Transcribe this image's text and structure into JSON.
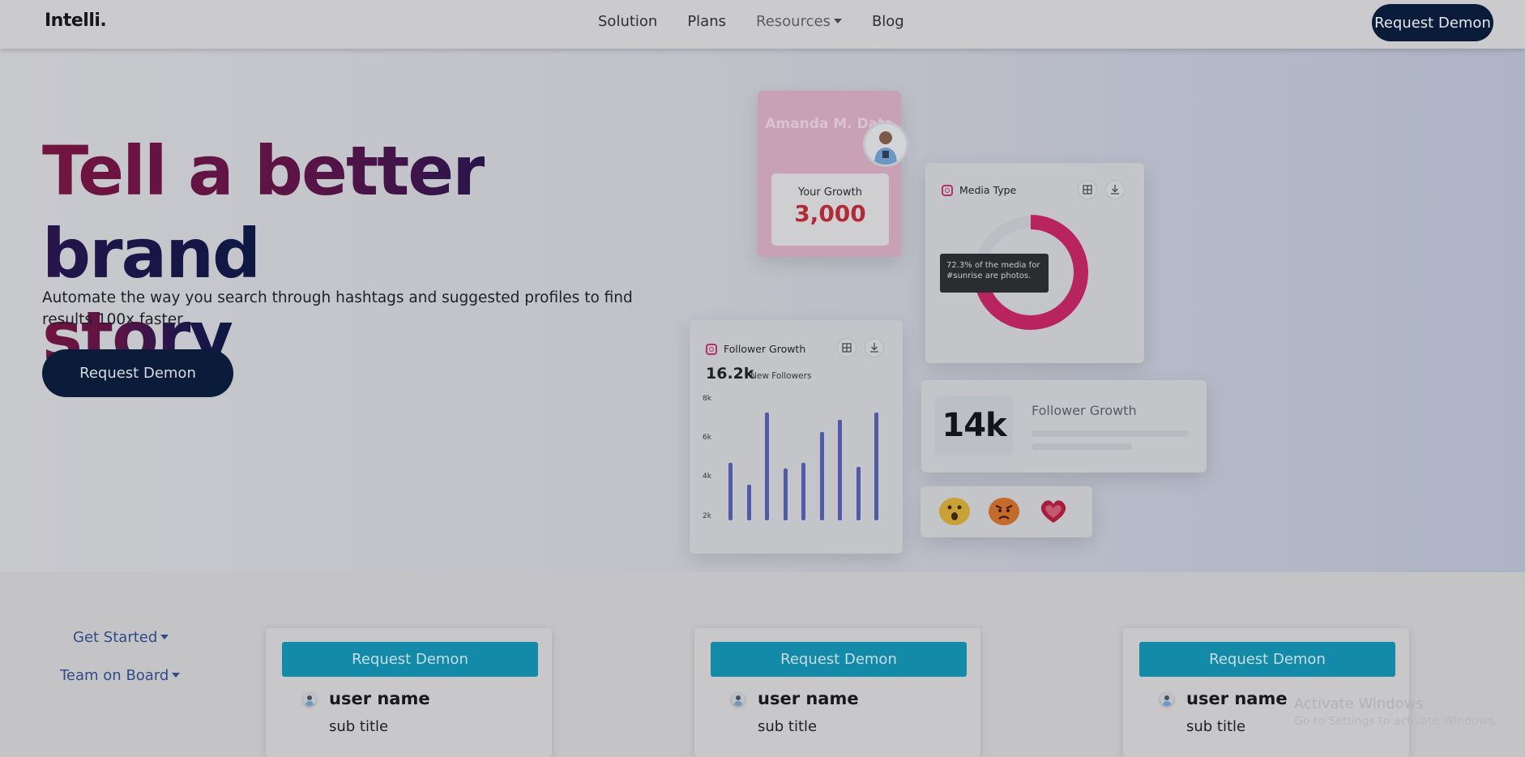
{
  "nav": {
    "brand": "Intelli.",
    "links": [
      "Solution",
      "Plans",
      "Resources",
      "Blog"
    ],
    "cta": "Request Demon"
  },
  "hero": {
    "title_line1": "Tell a better brand",
    "title_line2": "story",
    "subtitle": "Automate the way you search through hashtags and suggested profiles to find results 100x faster.",
    "cta": "Request Demon"
  },
  "profile_card": {
    "name": "Amanda M. Data",
    "growth_label": "Your Growth",
    "growth_value": "3,000"
  },
  "media_card": {
    "title": "Media Type",
    "tooltip": "72.3% of the media for #sunrise are photos.",
    "photo_share": 0.723
  },
  "follower_card": {
    "title": "Follower Growth",
    "value": "16.2k",
    "value_label": "New Followers",
    "y_ticks": [
      "8k",
      "6k",
      "4k",
      "2k"
    ]
  },
  "chart_data": {
    "type": "bar",
    "title": "Follower Growth",
    "xlabel": "",
    "ylabel": "",
    "ylim": [
      0,
      8000
    ],
    "values": [
      4700,
      3600,
      7300,
      4400,
      4700,
      6300,
      6900,
      4500,
      7300
    ]
  },
  "stat_card": {
    "value": "14k",
    "label": "Follower Growth"
  },
  "reactions": [
    "wow-emoji",
    "angry-emoji",
    "heart-emoji"
  ],
  "lower": {
    "side_links": [
      "Get Started",
      "Team on Board"
    ],
    "cards": [
      {
        "button": "Request Demon",
        "name": "user name",
        "subtitle": "sub title"
      },
      {
        "button": "Request Demon",
        "name": "user name",
        "subtitle": "sub title"
      },
      {
        "button": "Request Demon",
        "name": "user name",
        "subtitle": "sub title"
      }
    ]
  },
  "watermark": {
    "line1": "Activate Windows",
    "line2": "Go to Settings to activate Windows."
  },
  "colors": {
    "brand_navy": "#0b1c3a",
    "accent_pink": "#b8245f",
    "bar_blue": "#505aa8",
    "button_teal": "#128aa8"
  }
}
